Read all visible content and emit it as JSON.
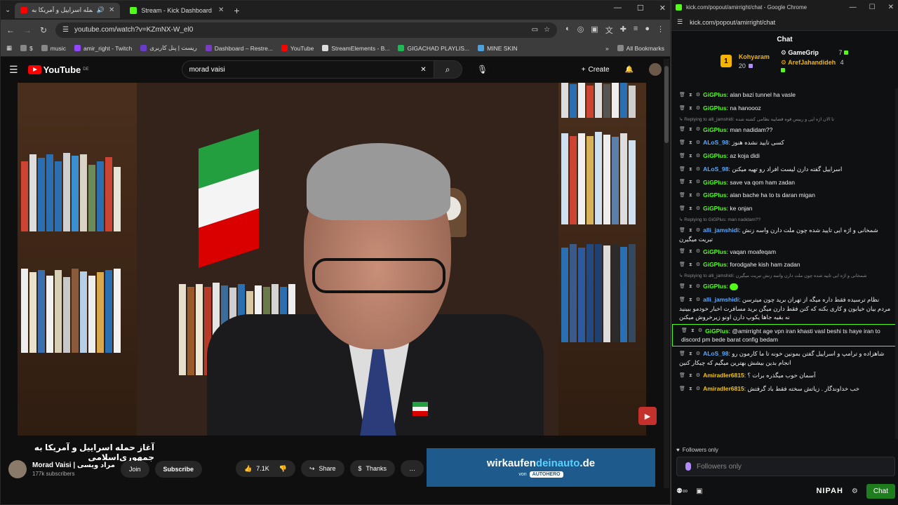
{
  "left": {
    "tabs": [
      {
        "label": "آغاز حمله اسراییل و آمریکا به",
        "active": true
      },
      {
        "label": "Stream - Kick Dashboard",
        "active": false
      }
    ],
    "url": "youtube.com/watch?v=KZmNX-W_el0",
    "bookmarks": [
      "$",
      "music",
      "amir_right - Twitch",
      "ریست | پنل کاربری",
      "Dashboard – Restre...",
      "YouTube",
      "StreamElements - B...",
      "GIGACHAD PLAYLIS...",
      "MINE SKIN",
      "All Bookmarks"
    ],
    "yt": {
      "logo": "YouTube",
      "region": "DE",
      "search_value": "morad vaisi",
      "create": "Create"
    },
    "video_title": "آغاز حمله اسراییل و آمریکا به جمهوری‌اسلامی",
    "channel": {
      "name": "Morad Vaisi | مراد ویسی",
      "subs": "177k subscribers",
      "join": "Join",
      "subscribe": "Subscribe"
    },
    "actions": {
      "likes": "7.1K",
      "share": "Share",
      "thanks": "Thanks"
    },
    "ad": {
      "brand_a": "wirkaufen",
      "brand_b": "deinauto",
      "brand_c": ".de",
      "by": "von",
      "sub_brand": "AUTOHERO"
    }
  },
  "right": {
    "window_title": "kick.com/popout/amirright/chat - Google Chrome",
    "url": "kick.com/popout/amirright/chat",
    "chat_title": "Chat",
    "leaderboard": [
      {
        "name": "Kohyaram",
        "count": "20"
      },
      {
        "name": "GameGrip",
        "count": "7"
      },
      {
        "name": "ArefJahandideh",
        "count": "4"
      }
    ],
    "messages": [
      {
        "user": "GiGPlus",
        "color": "g",
        "text": "alan bazi tunnel ha vasle"
      },
      {
        "user": "GiGPlus",
        "color": "g",
        "text": "na hanoooz"
      },
      {
        "reply": "Replying to alli_jamshidi: تا الان اژه ایی و رییس قوه قضاییه نظامی کشته شده"
      },
      {
        "user": "GiGPlus",
        "color": "g",
        "text": "man nadidam??"
      },
      {
        "user": "ALoS_98",
        "color": "b",
        "text": "کسی تایید نشده هنوز"
      },
      {
        "user": "GiGPlus",
        "color": "g",
        "text": "az koja didi"
      },
      {
        "user": "ALoS_98",
        "color": "b",
        "text": "اسراییل گفته دارن لیست افراد رو تهیه میکنن"
      },
      {
        "user": "GiGPlus",
        "color": "g",
        "text": "save va qom ham zadan"
      },
      {
        "user": "GiGPlus",
        "color": "g",
        "text": "alan bache ha to ts daran migan"
      },
      {
        "user": "GiGPlus",
        "color": "g",
        "text": "ke onjan"
      },
      {
        "reply": "Replying to GiGPlus: man nadidam??"
      },
      {
        "user": "alli_jamshidi",
        "color": "b",
        "text": "شمخانی و اژه ایی تایید شده چون ملت دارن واسه زنش تبریت میگیرن"
      },
      {
        "user": "GiGPlus",
        "color": "g",
        "text": "vaqan moafeqam"
      },
      {
        "user": "GiGPlus",
        "color": "g",
        "text": "forodgahe kish ham zadan"
      },
      {
        "reply": "Replying to alli_jamshidi: شمخانی و اژه ایی تایید شده چون ملت دارن واسه زنش تبریت میگیرن"
      },
      {
        "user": "GiGPlus",
        "color": "g",
        "text": "",
        "emote": true
      },
      {
        "user": "alli_jamshidi",
        "color": "b",
        "text": "نظام ترسیده فقط داره میگه از تهران برید چون میترسن مردم بیان خیابون و کاری بکنه که کنن فقط دارن میگن برید مسافرت اخبار خودمو ببینید نه بقیه جاها یکوپ دارن اونو زیرخروش میکنن"
      },
      {
        "user": "GiGPlus",
        "color": "g",
        "text": "@amirright age vpn iran khasti vasl beshi ts haye iran to discord pm bede barat config bedam",
        "hl": true
      },
      {
        "user": "ALoS_98",
        "color": "b",
        "text": "شاهزاده و ترامپ و اسراییل گفتن بمونین خونه تا ما کارمون رو انجام بدین بیشش بهترین میگیم که چیکار کنین"
      },
      {
        "user": "Amiradler6815",
        "color": "y",
        "text": "آسمان خوب میگذره برات ؟"
      },
      {
        "user": "Amiradler6815",
        "color": "y",
        "text": "خب خداوندگار . زیاتش سخته فقط باد گرفتش"
      }
    ],
    "followers_label": "Followers only",
    "followers_placeholder": "Followers only",
    "brand": "NIPAH",
    "chat_button": "Chat"
  }
}
